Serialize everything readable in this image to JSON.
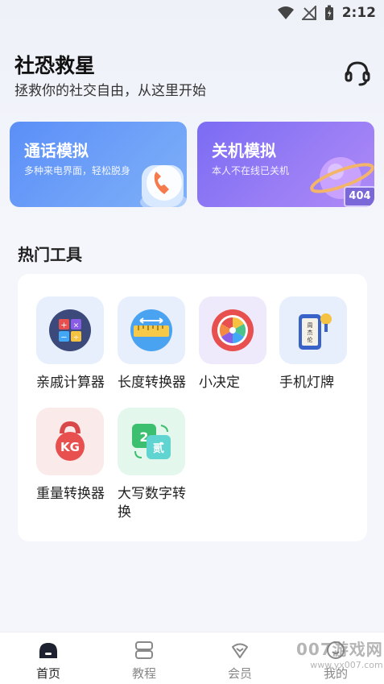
{
  "status": {
    "time": "2:12"
  },
  "header": {
    "title": "社恐救星",
    "subtitle": "拯救你的社交自由，从这里开始"
  },
  "cards": [
    {
      "title": "通话模拟",
      "desc": "多种来电界面，轻松脱身"
    },
    {
      "title": "关机模拟",
      "desc": "本人不在线已关机",
      "badge": "404"
    }
  ],
  "section": {
    "title": "热门工具"
  },
  "tools": [
    {
      "label": "亲戚计算器",
      "icon": "calculator-icon"
    },
    {
      "label": "长度转换器",
      "icon": "ruler-icon"
    },
    {
      "label": "小决定",
      "icon": "wheel-icon"
    },
    {
      "label": "手机灯牌",
      "icon": "phone-lightboard-icon"
    },
    {
      "label": "重量转换器",
      "icon": "kettlebell-icon"
    },
    {
      "label": "大写数字转换",
      "icon": "number-convert-icon"
    }
  ],
  "tabs": [
    {
      "label": "首页",
      "active": true
    },
    {
      "label": "教程",
      "active": false
    },
    {
      "label": "会员",
      "active": false
    },
    {
      "label": "我的",
      "active": false
    }
  ],
  "watermark": {
    "text": "007游戏网",
    "sub": "www.yx007.com"
  }
}
